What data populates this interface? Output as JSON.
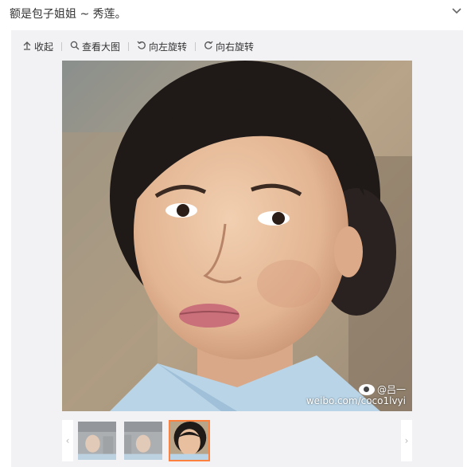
{
  "post": {
    "text": "额是包子姐姐 ~ 秀莲。"
  },
  "toolbar": {
    "collapse_label": "收起",
    "view_large_label": "查看大图",
    "rotate_left_label": "向左旋转",
    "rotate_right_label": "向右旋转"
  },
  "photo": {
    "watermark_author": "@吕一",
    "watermark_url": "weibo.com/coco1lvyi"
  },
  "thumbnails": [
    {
      "name": "thumb-1",
      "active": false
    },
    {
      "name": "thumb-2",
      "active": false
    },
    {
      "name": "thumb-3",
      "active": true
    }
  ],
  "icons": {
    "collapse": "collapse-arrow-icon",
    "search": "search-icon",
    "rotate_left": "rotate-left-icon",
    "rotate_right": "rotate-right-icon",
    "chevron": "chevron-down-icon",
    "weibo_eye": "weibo-eye-icon"
  },
  "colors": {
    "panel_bg": "#f2f2f5",
    "active_thumb_border": "#ff8140",
    "text": "#333333"
  }
}
